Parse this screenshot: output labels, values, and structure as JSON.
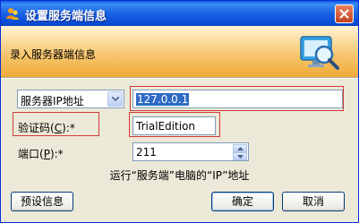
{
  "window": {
    "title": "设置服务端信息"
  },
  "header": {
    "text": "录入服务器端信息"
  },
  "form": {
    "address_type": {
      "value": "服务器IP地址"
    },
    "address": {
      "value": "127.0.0.1"
    },
    "code": {
      "label": "验证码",
      "accel": "C",
      "req": ":*",
      "value": "TrialEdition"
    },
    "port": {
      "label": "端口",
      "accel": "P",
      "req": ":*",
      "value": "211"
    }
  },
  "hint": "运行“服务端”电脑的“IP”地址",
  "buttons": {
    "preset": "预设信息",
    "ok": "确定",
    "cancel": "取消"
  },
  "colors": {
    "title_bar": "#0a58e6",
    "highlight_box": "#d23a3a",
    "selection": "#316ac5"
  }
}
